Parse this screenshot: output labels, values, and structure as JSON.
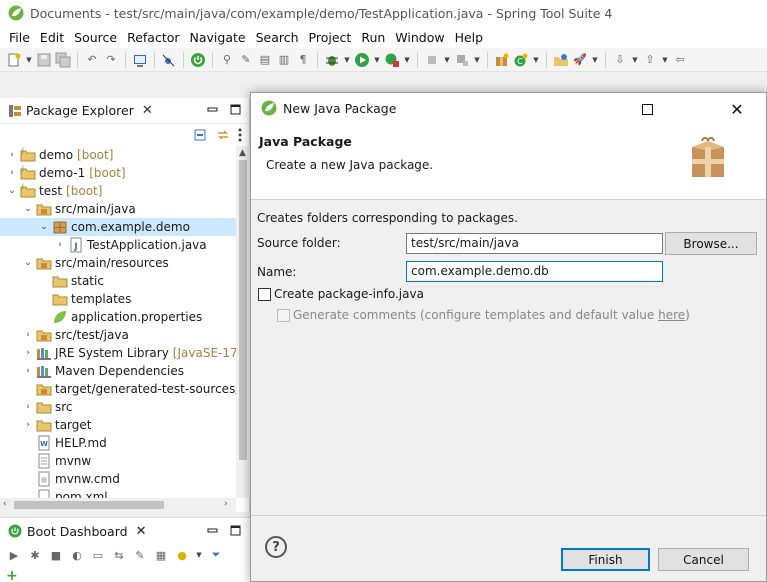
{
  "window": {
    "title": "Documents - test/src/main/java/com/example/demo/TestApplication.java - Spring Tool Suite 4"
  },
  "menu": [
    "File",
    "Edit",
    "Source",
    "Refactor",
    "Navigate",
    "Search",
    "Project",
    "Run",
    "Window",
    "Help"
  ],
  "package_explorer": {
    "tab_label": "Package Explorer",
    "items": [
      {
        "label": "demo",
        "suffix": "[boot]",
        "depth": 0,
        "twisty": "›",
        "icon": "project-icon"
      },
      {
        "label": "demo-1",
        "suffix": "[boot]",
        "depth": 0,
        "twisty": "›",
        "icon": "project-icon"
      },
      {
        "label": "test",
        "suffix": "[boot]",
        "depth": 0,
        "twisty": "⌄",
        "icon": "project-icon"
      },
      {
        "label": "src/main/java",
        "suffix": "",
        "depth": 1,
        "twisty": "⌄",
        "icon": "source-folder-icon"
      },
      {
        "label": "com.example.demo",
        "suffix": "",
        "depth": 2,
        "twisty": "⌄",
        "icon": "package-icon",
        "selected": true
      },
      {
        "label": "TestApplication.java",
        "suffix": "",
        "depth": 3,
        "twisty": "›",
        "icon": "java-file-icon"
      },
      {
        "label": "src/main/resources",
        "suffix": "",
        "depth": 1,
        "twisty": "⌄",
        "icon": "source-folder-icon"
      },
      {
        "label": "static",
        "suffix": "",
        "depth": 2,
        "twisty": "",
        "icon": "folder-icon"
      },
      {
        "label": "templates",
        "suffix": "",
        "depth": 2,
        "twisty": "",
        "icon": "folder-icon"
      },
      {
        "label": "application.properties",
        "suffix": "",
        "depth": 2,
        "twisty": "",
        "icon": "properties-file-icon"
      },
      {
        "label": "src/test/java",
        "suffix": "",
        "depth": 1,
        "twisty": "›",
        "icon": "source-folder-icon"
      },
      {
        "label": "JRE System Library",
        "suffix": "[JavaSE-17]",
        "depth": 1,
        "twisty": "›",
        "icon": "library-icon"
      },
      {
        "label": "Maven Dependencies",
        "suffix": "",
        "depth": 1,
        "twisty": "›",
        "icon": "library-icon"
      },
      {
        "label": "target/generated-test-sources/tes",
        "suffix": "",
        "depth": 1,
        "twisty": "",
        "icon": "source-folder-icon"
      },
      {
        "label": "src",
        "suffix": "",
        "depth": 1,
        "twisty": "›",
        "icon": "folder-icon"
      },
      {
        "label": "target",
        "suffix": "",
        "depth": 1,
        "twisty": "›",
        "icon": "folder-icon"
      },
      {
        "label": "HELP.md",
        "suffix": "",
        "depth": 1,
        "twisty": "",
        "icon": "markdown-file-icon"
      },
      {
        "label": "mvnw",
        "suffix": "",
        "depth": 1,
        "twisty": "",
        "icon": "text-file-icon"
      },
      {
        "label": "mvnw.cmd",
        "suffix": "",
        "depth": 1,
        "twisty": "",
        "icon": "cmd-file-icon"
      },
      {
        "label": "pom.xml",
        "suffix": "",
        "depth": 1,
        "twisty": "",
        "icon": "xml-file-icon"
      }
    ]
  },
  "boot_dashboard": {
    "tab_label": "Boot Dashboard"
  },
  "dialog": {
    "title": "New Java Package",
    "header": "Java Package",
    "subheader": "Create a new Java package.",
    "description": "Creates folders corresponding to packages.",
    "source_folder_label": "Source folder:",
    "source_folder_value": "test/src/main/java",
    "browse_label": "Browse...",
    "name_label": "Name:",
    "name_value": "com.example.demo.db",
    "create_info_label": "Create package-info.java",
    "generate_comments_label": "Generate comments (configure templates and default value ",
    "generate_comments_link": "here",
    "generate_comments_end": ")",
    "finish_label": "Finish",
    "cancel_label": "Cancel"
  },
  "colors": {
    "selection": "#cce8ff",
    "primary_button_border": "#0078d7",
    "decorator_text": "#a08440"
  }
}
